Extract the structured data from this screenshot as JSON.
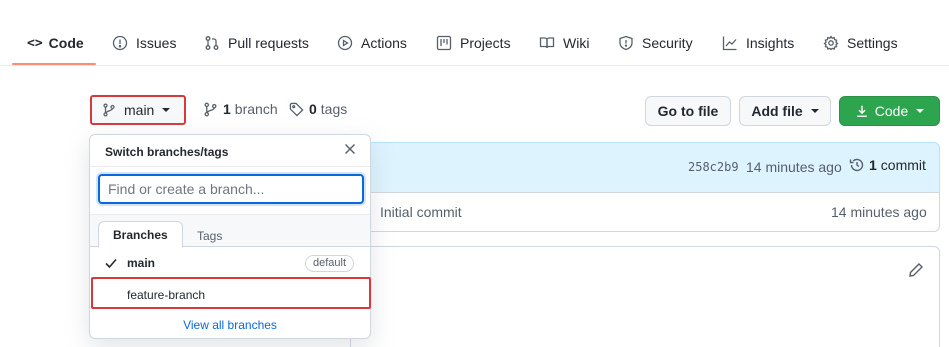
{
  "nav": {
    "tabs": [
      {
        "label": "Code",
        "icon": "code-icon"
      },
      {
        "label": "Issues",
        "icon": "issue-icon"
      },
      {
        "label": "Pull requests",
        "icon": "pull-request-icon"
      },
      {
        "label": "Actions",
        "icon": "play-icon"
      },
      {
        "label": "Projects",
        "icon": "project-icon"
      },
      {
        "label": "Wiki",
        "icon": "book-icon"
      },
      {
        "label": "Security",
        "icon": "shield-icon"
      },
      {
        "label": "Insights",
        "icon": "graph-icon"
      },
      {
        "label": "Settings",
        "icon": "gear-icon"
      }
    ],
    "active_tab": "Code"
  },
  "toolbar": {
    "branch_name": "main",
    "branch_count": "1",
    "branch_label": "branch",
    "tag_count": "0",
    "tag_label": "tags",
    "go_to_file": "Go to file",
    "add_file": "Add file",
    "code_button": "Code"
  },
  "commit": {
    "hash": "258c2b9",
    "time": "14 minutes ago",
    "count": "1",
    "count_label": "commit",
    "file_message": "Initial commit",
    "file_time": "14 minutes ago"
  },
  "dropdown": {
    "title": "Switch branches/tags",
    "filter_placeholder": "Find or create a branch...",
    "tabs": [
      "Branches",
      "Tags"
    ],
    "branches": [
      {
        "name": "main",
        "badge": "default",
        "checked": true
      },
      {
        "name": "feature-branch",
        "badge": "",
        "checked": false
      }
    ],
    "footer_link": "View all branches"
  },
  "colors": {
    "accent_blue": "#0969da",
    "green_button": "#2da44e",
    "highlight_red": "#d73a3a",
    "tab_underline": "#fd8c73"
  }
}
